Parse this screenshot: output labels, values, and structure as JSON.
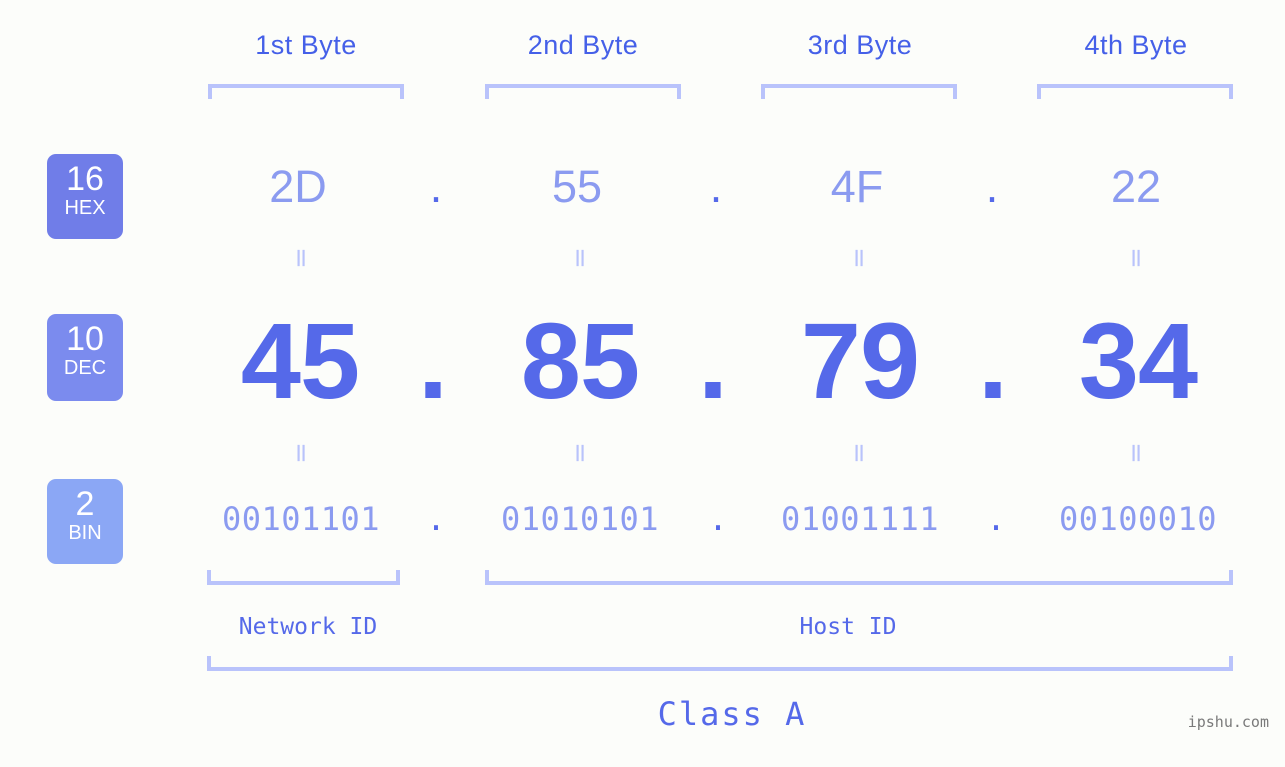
{
  "background_color": "#fcfdfa",
  "accent_color": "#5569e9",
  "muted_accent_color": "#8b9bf0",
  "bracket_color": "#b9c3fb",
  "header": {
    "byte_labels": [
      {
        "label": "1st Byte"
      },
      {
        "label": "2nd Byte"
      },
      {
        "label": "3rd Byte"
      },
      {
        "label": "4th Byte"
      }
    ]
  },
  "rows": [
    {
      "base": "16",
      "abbr": "HEX",
      "badge_color": "#707de8",
      "values": [
        "2D",
        "55",
        "4F",
        "22"
      ],
      "separator": "."
    },
    {
      "base": "10",
      "abbr": "DEC",
      "badge_color": "#7b8bee",
      "values": [
        "45",
        "85",
        "79",
        "34"
      ],
      "separator": "."
    },
    {
      "base": "2",
      "abbr": "BIN",
      "badge_color": "#8ba7f5",
      "values": [
        "00101101",
        "01010101",
        "01001111",
        "00100010"
      ],
      "separator": "."
    }
  ],
  "equality_marks": [
    "=",
    "=",
    "=",
    "=",
    "=",
    "=",
    "=",
    "="
  ],
  "sections": [
    {
      "label": "Network ID"
    },
    {
      "label": "Host ID"
    }
  ],
  "class": {
    "label": "Class A"
  },
  "watermark": {
    "text": "ipshu.com"
  }
}
